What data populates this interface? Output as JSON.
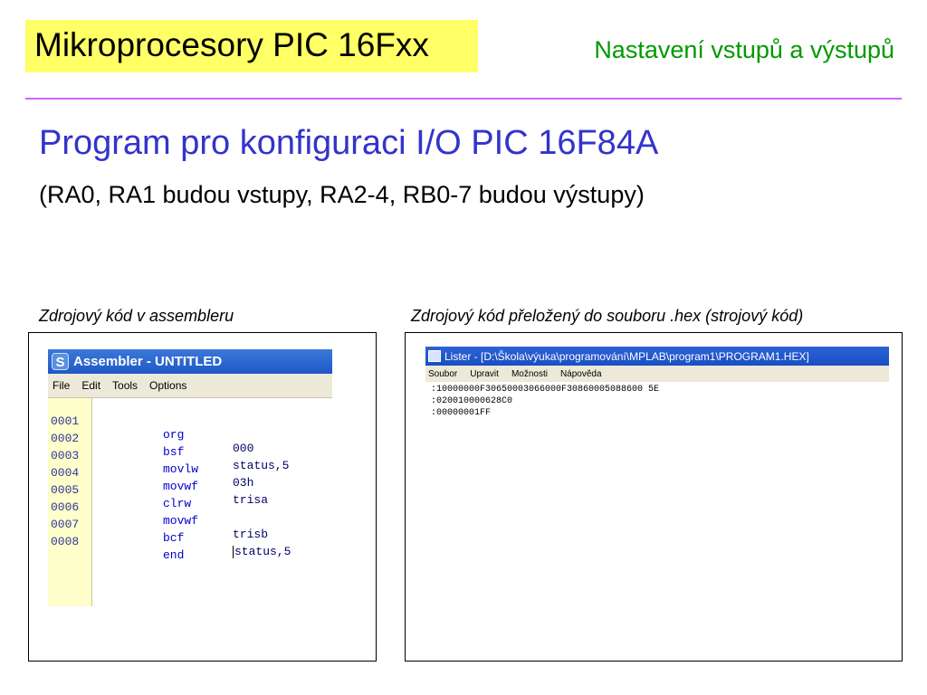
{
  "header": {
    "title": "Mikroprocesory PIC 16Fxx",
    "subtitle": "Nastavení vstupů a výstupů"
  },
  "heading": {
    "main": "Program pro konfiguraci I/O PIC 16F84A",
    "sub": "(RA0, RA1 budou vstupy, RA2-4, RB0-7 budou výstupy)"
  },
  "captions": {
    "left": "Zdrojový kód v assembleru",
    "right": "Zdrojový kód přeložený do souboru .hex (strojový kód)"
  },
  "assembler": {
    "title": "Assembler - UNTITLED",
    "icon": "S",
    "menu": [
      "File",
      "Edit",
      "Tools",
      "Options"
    ],
    "lines": [
      {
        "num": "0001",
        "mnemonic": "org",
        "operand": "000"
      },
      {
        "num": "0002",
        "mnemonic": "bsf",
        "operand": "status,5"
      },
      {
        "num": "0003",
        "mnemonic": "movlw",
        "operand": "03h"
      },
      {
        "num": "0004",
        "mnemonic": "movwf",
        "operand": "trisa"
      },
      {
        "num": "0005",
        "mnemonic": "clrw",
        "operand": ""
      },
      {
        "num": "0006",
        "mnemonic": "movwf",
        "operand": "trisb"
      },
      {
        "num": "0007",
        "mnemonic": "bcf",
        "operand": "status,5"
      },
      {
        "num": "0008",
        "mnemonic": "end",
        "operand": ""
      }
    ]
  },
  "lister": {
    "title": "Lister - [D:\\Škola\\výuka\\programování\\MPLAB\\program1\\PROGRAM1.HEX]",
    "menu": [
      "Soubor",
      "Upravit",
      "Možnosti",
      "Nápověda"
    ],
    "lines": [
      ":10000000F30650003066000F30860005088600 5E",
      ":020010000628C0",
      ":00000001FF"
    ]
  }
}
